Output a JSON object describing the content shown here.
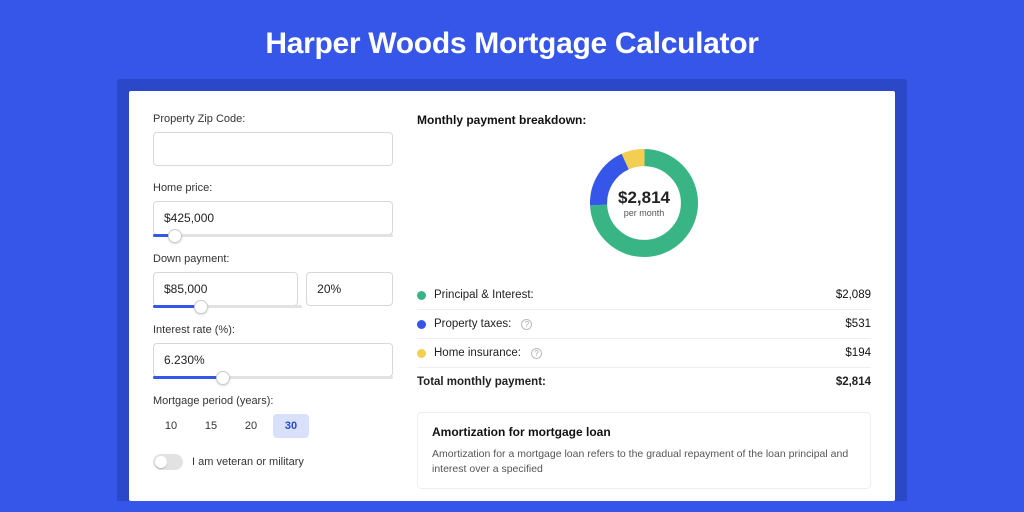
{
  "page_title": "Harper Woods Mortgage Calculator",
  "form": {
    "zip": {
      "label": "Property Zip Code:",
      "value": ""
    },
    "price": {
      "label": "Home price:",
      "value": "$425,000",
      "slider_pct": 9
    },
    "down": {
      "label": "Down payment:",
      "value": "$85,000",
      "pct": "20%",
      "slider_pct": 20
    },
    "rate": {
      "label": "Interest rate (%):",
      "value": "6.230%",
      "slider_pct": 29
    },
    "period": {
      "label": "Mortgage period (years):",
      "options": [
        "10",
        "15",
        "20",
        "30"
      ],
      "active": "30"
    },
    "veteran": {
      "label": "I am veteran or military"
    }
  },
  "breakdown": {
    "heading": "Monthly payment breakdown:",
    "donut_total": "$2,814",
    "donut_sub": "per month",
    "items": [
      {
        "label": "Principal & Interest:",
        "value": "$2,089",
        "color": "#39b585",
        "help": false
      },
      {
        "label": "Property taxes:",
        "value": "$531",
        "color": "#3556e8",
        "help": true
      },
      {
        "label": "Home insurance:",
        "value": "$194",
        "color": "#f2cf52",
        "help": true
      }
    ],
    "total_label": "Total monthly payment:",
    "total_value": "$2,814"
  },
  "chart_data": {
    "type": "pie",
    "title": "Monthly payment breakdown",
    "total": 2814,
    "unit": "USD per month",
    "series": [
      {
        "name": "Principal & Interest",
        "value": 2089,
        "color": "#39b585"
      },
      {
        "name": "Property taxes",
        "value": 531,
        "color": "#3556e8"
      },
      {
        "name": "Home insurance",
        "value": 194,
        "color": "#f2cf52"
      }
    ]
  },
  "amortization": {
    "heading": "Amortization for mortgage loan",
    "body": "Amortization for a mortgage loan refers to the gradual repayment of the loan principal and interest over a specified"
  }
}
